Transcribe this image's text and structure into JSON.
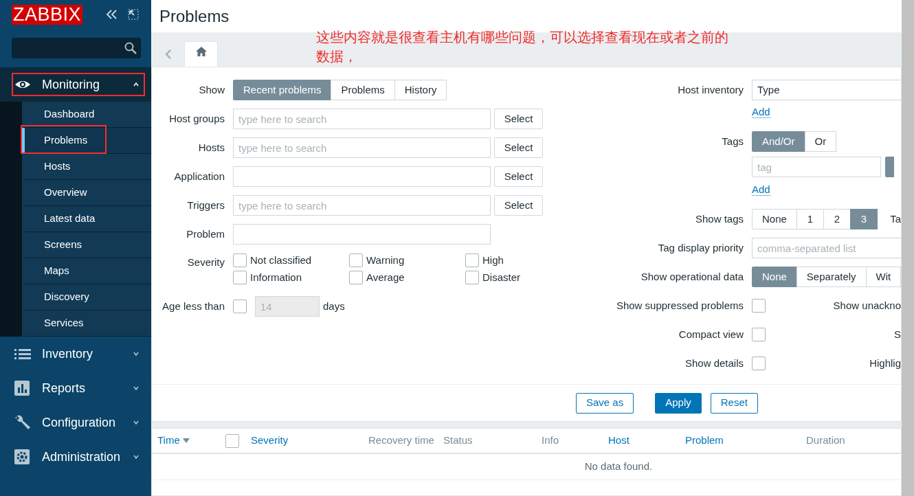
{
  "sidebar": {
    "logo": "ZABBIX",
    "menu": [
      {
        "label": "Monitoring",
        "expanded": true,
        "annotated": true,
        "children": [
          {
            "label": "Dashboard",
            "selected": false,
            "annotated": false
          },
          {
            "label": "Problems",
            "selected": true,
            "annotated": true
          },
          {
            "label": "Hosts",
            "selected": false,
            "annotated": false
          },
          {
            "label": "Overview",
            "selected": false,
            "annotated": false
          },
          {
            "label": "Latest data",
            "selected": false,
            "annotated": false
          },
          {
            "label": "Screens",
            "selected": false,
            "annotated": false
          },
          {
            "label": "Maps",
            "selected": false,
            "annotated": false
          },
          {
            "label": "Discovery",
            "selected": false,
            "annotated": false
          },
          {
            "label": "Services",
            "selected": false,
            "annotated": false
          }
        ]
      },
      {
        "label": "Inventory",
        "expanded": false,
        "annotated": false
      },
      {
        "label": "Reports",
        "expanded": false,
        "annotated": false
      },
      {
        "label": "Configuration",
        "expanded": false,
        "annotated": false
      },
      {
        "label": "Administration",
        "expanded": false,
        "annotated": false
      }
    ]
  },
  "page_title": "Problems",
  "annotation": {
    "text": "这些内容就是很查看主机有哪些问题，可以选择查看现在或者之前的数据，"
  },
  "filter_left": [
    {
      "kind": "segmented",
      "label": "Show",
      "options": [
        {
          "label": "Recent problems",
          "selected": true
        },
        {
          "label": "Problems",
          "selected": false
        },
        {
          "label": "History",
          "selected": false
        }
      ]
    },
    {
      "kind": "multiselect",
      "label": "Host groups",
      "placeholder": "type here to search",
      "button": "Select"
    },
    {
      "kind": "multiselect",
      "label": "Hosts",
      "placeholder": "type here to search",
      "button": "Select"
    },
    {
      "kind": "multiselect",
      "label": "Application",
      "button": "Select"
    },
    {
      "kind": "multiselect",
      "label": "Triggers",
      "placeholder": "type here to search",
      "button": "Select"
    },
    {
      "kind": "text",
      "label": "Problem"
    },
    {
      "kind": "checkboxes",
      "label": "Severity",
      "options": [
        {
          "label": "Not classified",
          "checked": false
        },
        {
          "label": "Information",
          "checked": false
        },
        {
          "label": "Warning",
          "checked": false
        },
        {
          "label": "Average",
          "checked": false
        },
        {
          "label": "High",
          "checked": false
        },
        {
          "label": "Disaster",
          "checked": false
        }
      ]
    },
    {
      "kind": "age",
      "label": "Age less than",
      "checked": false,
      "value": "14",
      "unit": "days"
    }
  ],
  "filter_right": [
    {
      "kind": "select",
      "label": "Host inventory",
      "value": "Type"
    },
    {
      "kind": "link",
      "text": "Add"
    },
    {
      "kind": "segmented",
      "label": "Tags",
      "options": [
        {
          "label": "And/Or",
          "selected": true
        },
        {
          "label": "Or",
          "selected": false
        }
      ]
    },
    {
      "kind": "tag_input",
      "placeholder": "tag"
    },
    {
      "kind": "link",
      "text": "Add"
    },
    {
      "kind": "segmented",
      "label": "Show tags",
      "options": [
        {
          "label": "None",
          "selected": false
        },
        {
          "label": "1",
          "selected": false
        },
        {
          "label": "2",
          "selected": false
        },
        {
          "label": "3",
          "selected": true
        }
      ],
      "trailing": "Ta"
    },
    {
      "kind": "text",
      "label": "Tag display priority",
      "placeholder": "comma-separated list"
    },
    {
      "kind": "segmented",
      "label": "Show operational data",
      "options": [
        {
          "label": "None",
          "selected": true
        },
        {
          "label": "Separately",
          "selected": false
        },
        {
          "label": "Wit",
          "selected": false
        }
      ]
    },
    {
      "kind": "checkbox",
      "label": "Show suppressed problems",
      "checked": false,
      "trailing": "Show unackno"
    },
    {
      "kind": "checkbox",
      "label": "Compact view",
      "checked": false,
      "trailing": "S"
    },
    {
      "kind": "checkbox",
      "label": "Show details",
      "checked": false,
      "trailing": "Highlig"
    }
  ],
  "buttons": [
    {
      "label": "Save as",
      "kind": "secondary"
    },
    {
      "label": "Apply",
      "kind": "primary"
    },
    {
      "label": "Reset",
      "kind": "secondary"
    }
  ],
  "table": {
    "columns": [
      {
        "kind": "link",
        "label": "Time",
        "sorted": true
      },
      {
        "kind": "checkbox",
        "checked": false
      },
      {
        "kind": "link",
        "label": "Severity",
        "sorted": false
      },
      {
        "kind": "plain",
        "label": "Recovery time"
      },
      {
        "kind": "plain",
        "label": "Status"
      },
      {
        "kind": "plain",
        "label": "Info"
      },
      {
        "kind": "link",
        "label": "Host",
        "sorted": false
      },
      {
        "kind": "link",
        "label": "Problem",
        "sorted": false
      },
      {
        "kind": "plain",
        "label": "Duration"
      }
    ],
    "empty_message": "No data found."
  }
}
